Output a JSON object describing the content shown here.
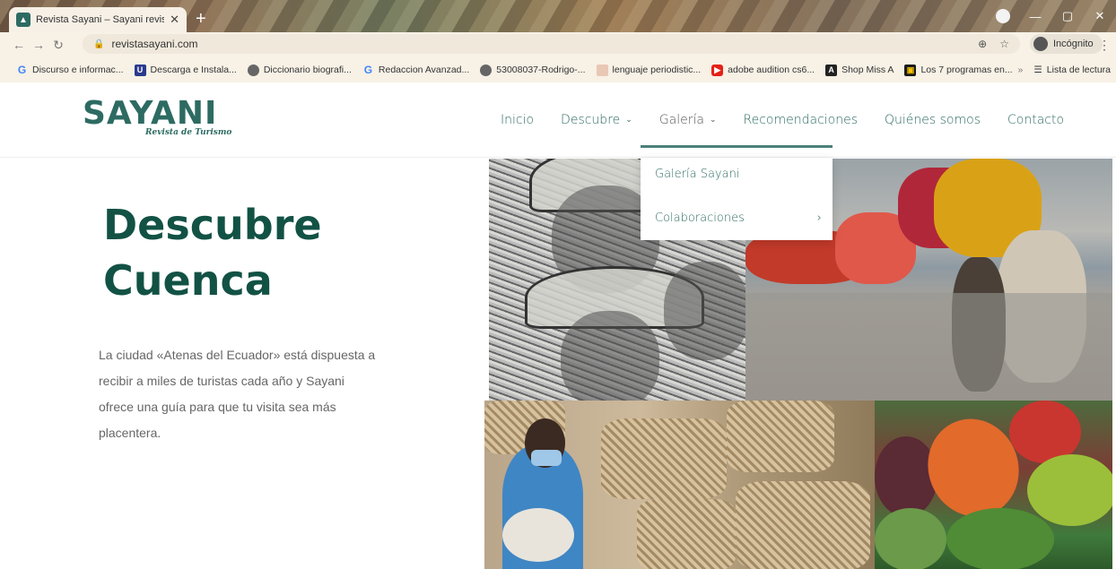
{
  "browser": {
    "tab_title": "Revista Sayani – Sayani revista d",
    "tab_close": "✕",
    "new_tab": "+",
    "url": "revistasayani.com",
    "profile_label": "Incógnito",
    "bookmarks": [
      {
        "icon": "G",
        "label": "Discurso e informac..."
      },
      {
        "icon": "U",
        "label": "Descarga e Instala..."
      },
      {
        "icon": "",
        "label": "Diccionario biografi..."
      },
      {
        "icon": "G",
        "label": "Redaccion Avanzad..."
      },
      {
        "icon": "",
        "label": "53008037-Rodrigo-..."
      },
      {
        "icon": "",
        "label": "lenguaje periodistic..."
      },
      {
        "icon": "▶",
        "label": "adobe audition cs6..."
      },
      {
        "icon": "A",
        "label": "Shop Miss A"
      },
      {
        "icon": "▣",
        "label": "Los 7 programas en..."
      }
    ],
    "bookmarks_overflow": "»",
    "reading_list": "Lista de lectura"
  },
  "site": {
    "logo_main": "SAYANI",
    "logo_sub": "Revista de Turismo",
    "nav": [
      {
        "label": "Inicio"
      },
      {
        "label": "Descubre",
        "caret": "⌄"
      },
      {
        "label": "Galería",
        "caret": "⌄"
      },
      {
        "label": "Recomendaciones"
      },
      {
        "label": "Quiénes somos"
      },
      {
        "label": "Contacto"
      }
    ],
    "dropdown": {
      "items": [
        "Galería Sayani",
        "Colaboraciones"
      ],
      "submenu_arrow": "›"
    }
  },
  "hero": {
    "title_line1": "Descubre",
    "title_line2": "Cuenca",
    "text": "La ciudad «Atenas del Ecuador» está dispuesta a recibir a miles de turistas cada año y Sayani ofrece una guía para que tu visita sea más placentera."
  },
  "colors": {
    "brand": "#2d6b62",
    "title": "#125245",
    "text": "#666666"
  }
}
